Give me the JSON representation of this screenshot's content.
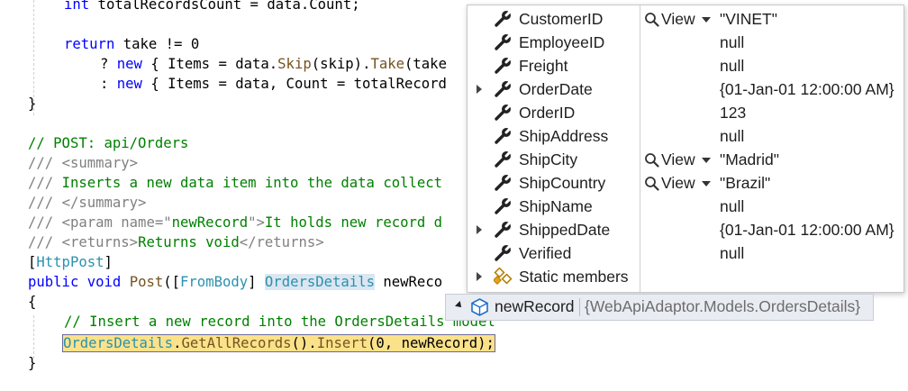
{
  "code": {
    "line1": "int totalRecordsCount = data.Count;",
    "line2_kw": "return",
    "line2_rest": " take != 0",
    "line3_q": "? ",
    "line3_kw": "new",
    "line3_a": " { Items = data.",
    "line3_m1": "Skip",
    "line3_b": "(skip).",
    "line3_m2": "Take",
    "line3_c": "(take",
    "line4_q": ": ",
    "line4_kw": "new",
    "line4_rest": " { Items = data, Count = totalRecord",
    "brace_close": "}",
    "comment_post": "// POST: api/Orders",
    "doc_summary_open_p": "/// ",
    "doc_summary_open_t": "<summary>",
    "doc_inserts_p": "/// ",
    "doc_inserts_t": "Inserts a new data item into the data collect",
    "doc_summary_close_p": "/// ",
    "doc_summary_close_t": "</summary>",
    "doc_param_p": "/// ",
    "doc_param_t1": "<param name=\"",
    "doc_param_t2": "newRecord",
    "doc_param_t3": "\">",
    "doc_param_t4": "It holds new record d",
    "doc_returns_p": "/// ",
    "doc_returns_t1": "<returns>",
    "doc_returns_t2": "Returns void",
    "doc_returns_t3": "</returns>",
    "attr_open": "[",
    "attr_name": "HttpPost",
    "attr_close": "]",
    "sig_kw1": "public",
    "sig_kw2": "void",
    "sig_method": "Post",
    "sig_p1": "([",
    "sig_attr": "FromBody",
    "sig_p2": "] ",
    "sig_type": "OrdersDetails",
    "sig_param": " newReco",
    "brace_open": "{",
    "comment_insert": "// Insert a new record into the OrdersDetails model",
    "stmt_type": "OrdersDetails",
    "stmt_a": ".",
    "stmt_m1": "GetAllRecords",
    "stmt_b": "().",
    "stmt_m2": "Insert",
    "stmt_c": "(0, newRecord);",
    "brace_close2": "}"
  },
  "datatip": {
    "header": {
      "name": "newRecord",
      "type": "{WebApiAdaptor.Models.OrdersDetails}"
    },
    "view_label": "View",
    "rows": [
      {
        "name": "CustomerID",
        "value": "\"VINET\"",
        "has_view": true,
        "expandable": false
      },
      {
        "name": "EmployeeID",
        "value": "null",
        "has_view": false,
        "expandable": false
      },
      {
        "name": "Freight",
        "value": "null",
        "has_view": false,
        "expandable": false
      },
      {
        "name": "OrderDate",
        "value": "{01-Jan-01 12:00:00 AM}",
        "has_view": false,
        "expandable": true
      },
      {
        "name": "OrderID",
        "value": "123",
        "has_view": false,
        "expandable": false
      },
      {
        "name": "ShipAddress",
        "value": "null",
        "has_view": false,
        "expandable": false
      },
      {
        "name": "ShipCity",
        "value": "\"Madrid\"",
        "has_view": true,
        "expandable": false
      },
      {
        "name": "ShipCountry",
        "value": "\"Brazil\"",
        "has_view": true,
        "expandable": false
      },
      {
        "name": "ShipName",
        "value": "null",
        "has_view": false,
        "expandable": false
      },
      {
        "name": "ShippedDate",
        "value": "{01-Jan-01 12:00:00 AM}",
        "has_view": false,
        "expandable": true
      },
      {
        "name": "Verified",
        "value": "null",
        "has_view": false,
        "expandable": false
      },
      {
        "name": "Static members",
        "value": "",
        "has_view": false,
        "expandable": true,
        "static": true
      }
    ]
  },
  "colors": {
    "keyword": "#0000ff",
    "type": "#2b91af",
    "comment": "#008000",
    "doc_tag": "#808080",
    "method": "#74531f",
    "highlight": "#fbe28a"
  }
}
